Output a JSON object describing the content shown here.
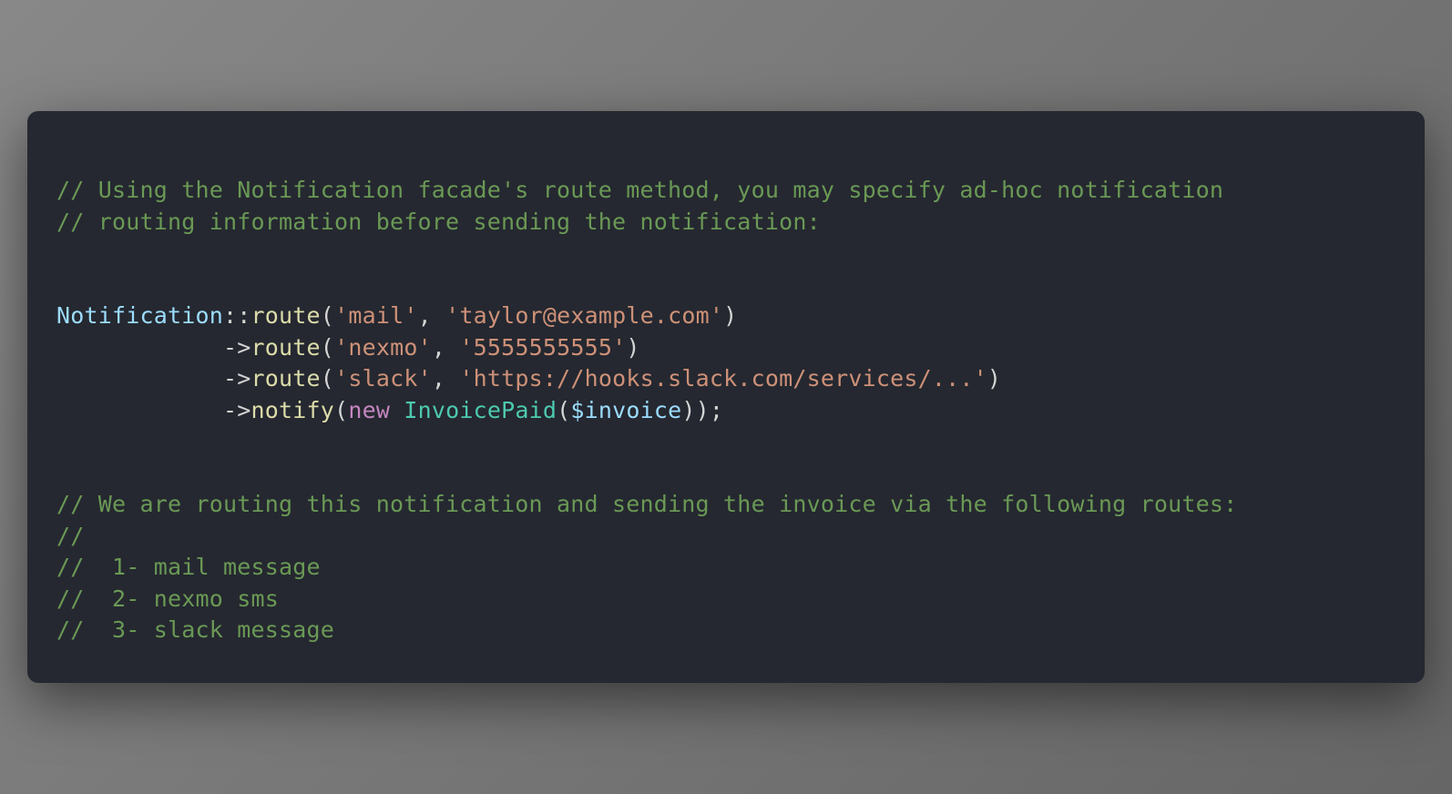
{
  "code": {
    "comment1": "// Using the Notification facade's route method, you may specify ad-hoc notification",
    "comment2": "// routing information before sending the notification:",
    "className": "Notification",
    "scope": "::",
    "method_route": "route",
    "method_notify": "notify",
    "arrow": "->",
    "lp": "(",
    "rp": ")",
    "comma": ", ",
    "semi": ";",
    "kw_new": "new",
    "type_invoice": "InvoicePaid",
    "var_invoice": "$invoice",
    "str_mail": "'mail'",
    "str_email": "'taylor@example.com'",
    "str_nexmo": "'nexmo'",
    "str_phone": "'5555555555'",
    "str_slack": "'slack'",
    "str_hook": "'https://hooks.slack.com/services/...'",
    "indent": "            ",
    "comment3": "// We are routing this notification and sending the invoice via the following routes:",
    "comment4": "//",
    "comment5": "//  1- mail message",
    "comment6": "//  2- nexmo sms",
    "comment7": "//  3- slack message"
  }
}
